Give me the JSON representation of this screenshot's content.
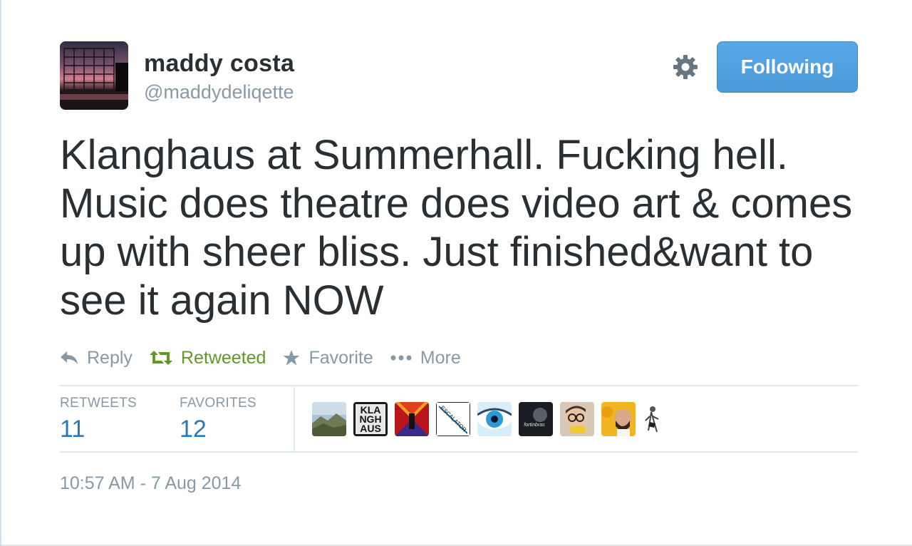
{
  "user": {
    "name": "maddy costa",
    "handle": "@maddydeliqette"
  },
  "follow_button": {
    "label": "Following",
    "color": "#55a4e3"
  },
  "tweet": {
    "text": "Klanghaus at Summerhall. Fucking hell. Music does theatre does video art & comes up with sheer bliss. Just finished&want to see it again NOW"
  },
  "actions": {
    "reply": "Reply",
    "retweet": "Retweeted",
    "favorite": "Favorite",
    "more": "More",
    "retweet_color": "#609928"
  },
  "stats": {
    "retweets_label": "RETWEETS",
    "retweets_count": "11",
    "favorites_label": "FAVORITES",
    "favorites_count": "12"
  },
  "favoriter_avatars": [
    {
      "kind": "mountain-photo"
    },
    {
      "kind": "klanghaus-logo",
      "text": [
        "KLA",
        "NGH",
        "AUS"
      ]
    },
    {
      "kind": "red-pattern"
    },
    {
      "kind": "escalator-logo",
      "text": "ESCALATOR"
    },
    {
      "kind": "eye-photo"
    },
    {
      "kind": "dark-logo",
      "text": "fortinbras"
    },
    {
      "kind": "glasses-person"
    },
    {
      "kind": "bearded-person"
    },
    {
      "kind": "figure-sketch"
    }
  ],
  "timestamp": "10:57 AM - 7 Aug 2014",
  "icons": [
    "gear-icon",
    "reply-icon",
    "retweet-icon",
    "star-icon",
    "more-dots-icon"
  ]
}
